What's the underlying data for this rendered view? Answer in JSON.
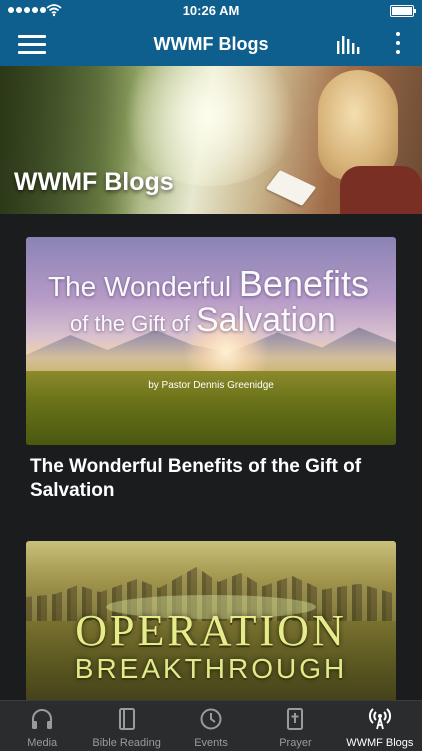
{
  "status_bar": {
    "time": "10:26 AM"
  },
  "nav": {
    "title": "WWMF Blogs"
  },
  "hero": {
    "title": "WWMF Blogs"
  },
  "posts": [
    {
      "title": "The Wonderful Benefits of the Gift of Salvation",
      "image_text": {
        "line1_prefix": "The Wonderful ",
        "line1_emph": "Benefits",
        "line2_prefix": "of the Gift of ",
        "line2_emph": "Salvation",
        "author": "by Pastor Dennis Greenidge"
      }
    },
    {
      "title": "",
      "image_text": {
        "line1": "OPERATION",
        "line2": "BREAKTHROUGH"
      }
    }
  ],
  "tabs": [
    {
      "label": "Media",
      "icon": "headphones-icon"
    },
    {
      "label": "Bible Reading",
      "icon": "book-icon"
    },
    {
      "label": "Events",
      "icon": "clock-icon"
    },
    {
      "label": "Prayer",
      "icon": "bible-cross-icon"
    },
    {
      "label": "WWMF Blogs",
      "icon": "broadcast-icon",
      "active": true
    }
  ],
  "colors": {
    "nav_bg": "#0e5f8e",
    "page_bg": "#1b1c1e",
    "tab_bg": "#2b2c2e"
  }
}
